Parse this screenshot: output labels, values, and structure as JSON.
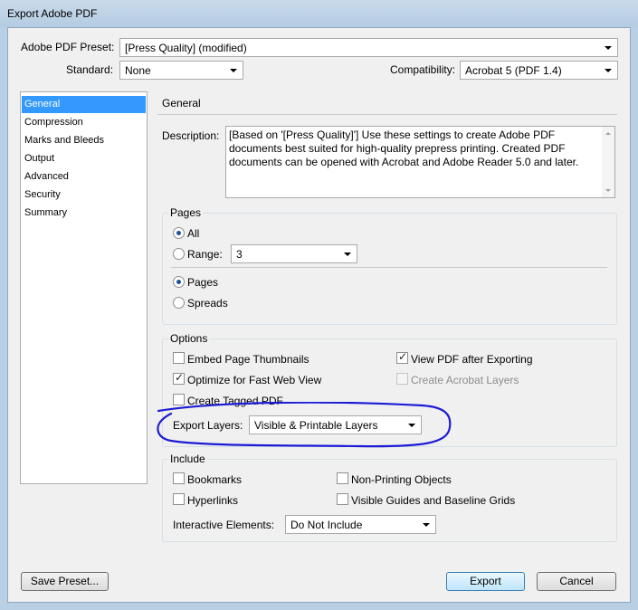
{
  "window": {
    "title": "Export Adobe PDF"
  },
  "header": {
    "preset_label": "Adobe PDF Preset:",
    "preset_value": "[Press Quality] (modified)",
    "standard_label": "Standard:",
    "standard_value": "None",
    "compat_label": "Compatibility:",
    "compat_value": "Acrobat 5 (PDF 1.4)"
  },
  "sidebar": {
    "items": [
      {
        "label": "General",
        "selected": true
      },
      {
        "label": "Compression"
      },
      {
        "label": "Marks and Bleeds"
      },
      {
        "label": "Output"
      },
      {
        "label": "Advanced"
      },
      {
        "label": "Security"
      },
      {
        "label": "Summary"
      }
    ]
  },
  "general": {
    "title": "General",
    "description_label": "Description:",
    "description_text": "[Based on '[Press Quality]'] Use these settings to create Adobe PDF documents best suited for high-quality prepress printing.  Created PDF documents can be opened with Acrobat and Adobe Reader 5.0 and later."
  },
  "pages": {
    "title": "Pages",
    "all_label": "All",
    "range_label": "Range:",
    "range_value": "3",
    "pages_label": "Pages",
    "spreads_label": "Spreads",
    "selected_scope": "All",
    "selected_mode": "Pages"
  },
  "options": {
    "title": "Options",
    "embed_thumbs": "Embed Page Thumbnails",
    "view_pdf": "View PDF after Exporting",
    "optimize": "Optimize for Fast Web View",
    "acrobat_layers": "Create Acrobat Layers",
    "tagged_pdf": "Create Tagged PDF",
    "export_layers_label": "Export Layers:",
    "export_layers_value": "Visible & Printable Layers",
    "checked": {
      "embed_thumbs": false,
      "view_pdf": true,
      "optimize": true,
      "acrobat_layers": false,
      "tagged_pdf": false
    },
    "annotation_color": "#1b1bd6"
  },
  "include": {
    "title": "Include",
    "bookmarks": "Bookmarks",
    "non_printing": "Non-Printing Objects",
    "hyperlinks": "Hyperlinks",
    "guides": "Visible Guides and Baseline Grids",
    "interactive_label": "Interactive Elements:",
    "interactive_value": "Do Not Include"
  },
  "footer": {
    "save_preset": "Save Preset...",
    "export": "Export",
    "cancel": "Cancel"
  },
  "colors": {
    "selection": "#3399ff",
    "title_bar": "#b9cfe4",
    "dialog_bg": "#f0f0f0"
  }
}
